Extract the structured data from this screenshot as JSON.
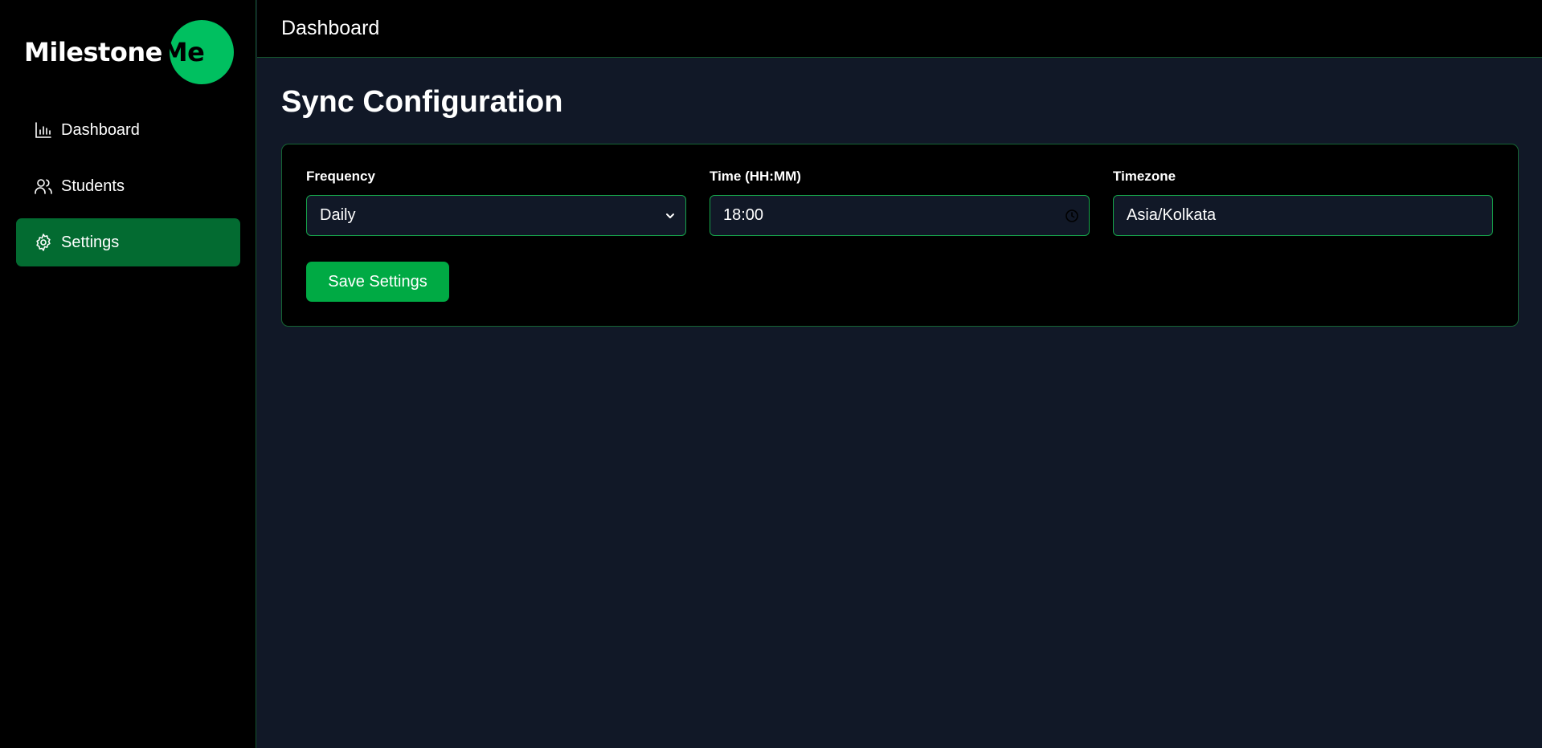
{
  "app": {
    "logo_text_white": "Milestone",
    "logo_text_dark": "Me",
    "brand_color": "#00c060"
  },
  "sidebar": {
    "items": [
      {
        "label": "Dashboard",
        "icon": "bar-chart-icon",
        "active": false
      },
      {
        "label": "Students",
        "icon": "users-icon",
        "active": false
      },
      {
        "label": "Settings",
        "icon": "gear-icon",
        "active": true
      }
    ]
  },
  "header": {
    "title": "Dashboard"
  },
  "main": {
    "title": "Sync Configuration",
    "form": {
      "frequency": {
        "label": "Frequency",
        "value": "Daily",
        "icon": "chevron-down-icon"
      },
      "time": {
        "label": "Time (HH:MM)",
        "value": "18:00",
        "icon": "clock-icon"
      },
      "timezone": {
        "label": "Timezone",
        "value": "Asia/Kolkata"
      },
      "save_label": "Save Settings"
    }
  },
  "colors": {
    "accent": "#00aa44",
    "active_nav": "#036b31",
    "border": "#16a34a",
    "background": "#111827"
  }
}
